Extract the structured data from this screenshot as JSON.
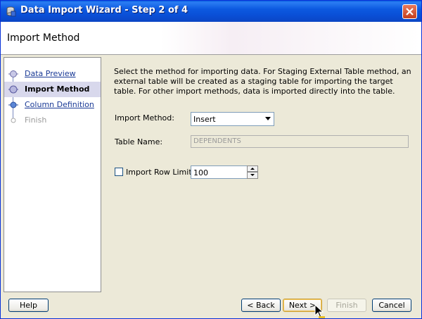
{
  "window": {
    "title": "Data Import Wizard - Step 2 of 4"
  },
  "header": {
    "title": "Import Method"
  },
  "steps": [
    {
      "label": "Data Preview",
      "state": "link"
    },
    {
      "label": "Import Method",
      "state": "current"
    },
    {
      "label": "Column Definition",
      "state": "link"
    },
    {
      "label": "Finish",
      "state": "disabled"
    }
  ],
  "main": {
    "description": "Select the method for importing data.  For Staging External Table method, an external table will be created as a staging table for importing the target table.  For other import methods, data is imported directly into the table.",
    "import_method_label": "Import Method:",
    "import_method_value": "Insert",
    "table_name_label": "Table Name:",
    "table_name_value": "DEPENDENTS",
    "row_limit_label": "Import Row Limit:",
    "row_limit_checked": false,
    "row_limit_value": "100"
  },
  "buttons": {
    "help": "Help",
    "back": "< Back",
    "next": "Next >",
    "finish": "Finish",
    "cancel": "Cancel"
  },
  "colors": {
    "titlebar": "#0A4FD6",
    "dialog_bg": "#ECE9D8",
    "link": "#1a3a96"
  }
}
